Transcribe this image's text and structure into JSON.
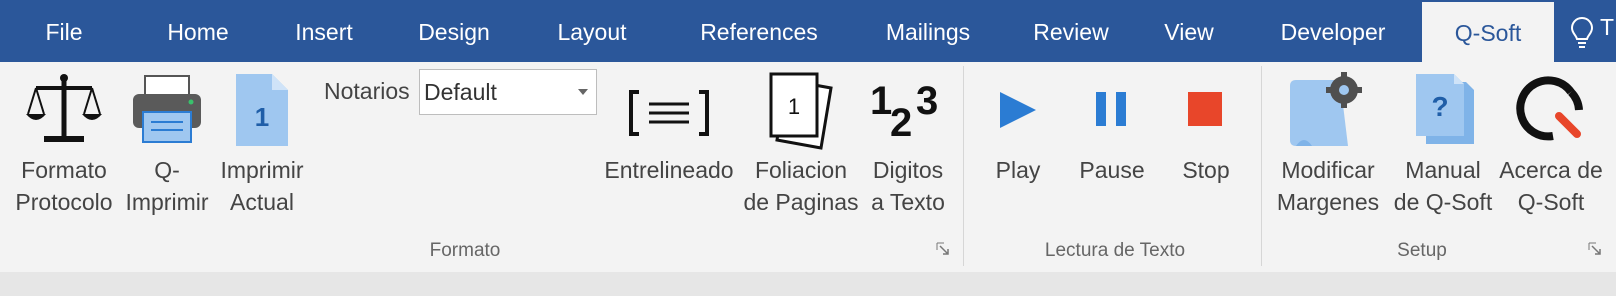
{
  "tabs": [
    {
      "label": "File",
      "active": false
    },
    {
      "label": "Home",
      "active": false
    },
    {
      "label": "Insert",
      "active": false
    },
    {
      "label": "Design",
      "active": false
    },
    {
      "label": "Layout",
      "active": false
    },
    {
      "label": "References",
      "active": false
    },
    {
      "label": "Mailings",
      "active": false
    },
    {
      "label": "Review",
      "active": false
    },
    {
      "label": "View",
      "active": false
    },
    {
      "label": "Developer",
      "active": false
    },
    {
      "label": "Q-Soft",
      "active": true
    }
  ],
  "tell_me": {
    "text": "T",
    "icon": "lightbulb-icon"
  },
  "groups": {
    "formato": {
      "label": "Formato",
      "buttons": {
        "formato_protocolo": {
          "line1": "Formato",
          "line2": "Protocolo",
          "icon": "scales-icon"
        },
        "q_imprimir": {
          "line1": "Q-",
          "line2": "Imprimir",
          "icon": "printer-icon"
        },
        "imprimir_actual": {
          "line1": "Imprimir",
          "line2": "Actual",
          "icon": "document-page-icon",
          "glyph": "1"
        },
        "entrelineado": {
          "line1": "Entrelineado",
          "line2": "",
          "icon": "line-spacing-icon"
        },
        "foliacion": {
          "line1": "Foliacion",
          "line2": "de Paginas",
          "icon": "page-numbering-icon",
          "glyph": "1"
        },
        "digitos": {
          "line1": "Digitos",
          "line2": "a Texto",
          "icon": "digits-icon",
          "glyph": "123"
        }
      },
      "notarios": {
        "label": "Notarios",
        "value": "Default"
      }
    },
    "lectura": {
      "label": "Lectura de Texto",
      "buttons": {
        "play": {
          "line1": "Play",
          "icon": "play-icon"
        },
        "pause": {
          "line1": "Pause",
          "icon": "pause-icon"
        },
        "stop": {
          "line1": "Stop",
          "icon": "stop-icon"
        }
      }
    },
    "setup": {
      "label": "Setup",
      "buttons": {
        "modificar": {
          "line1": "Modificar",
          "line2": "Margenes",
          "icon": "page-settings-icon"
        },
        "manual": {
          "line1": "Manual",
          "line2": "de Q-Soft",
          "icon": "help-document-icon",
          "glyph": "?"
        },
        "acerca": {
          "line1": "Acerca de",
          "line2": "Q-Soft",
          "icon": "qsoft-logo-icon"
        }
      }
    }
  },
  "colors": {
    "tab_bar": "#2b579a",
    "ribbon": "#f3f3f3",
    "accent_blue": "#2b7cd3",
    "light_blue": "#9fc7f0",
    "stop_red": "#e8462a"
  }
}
